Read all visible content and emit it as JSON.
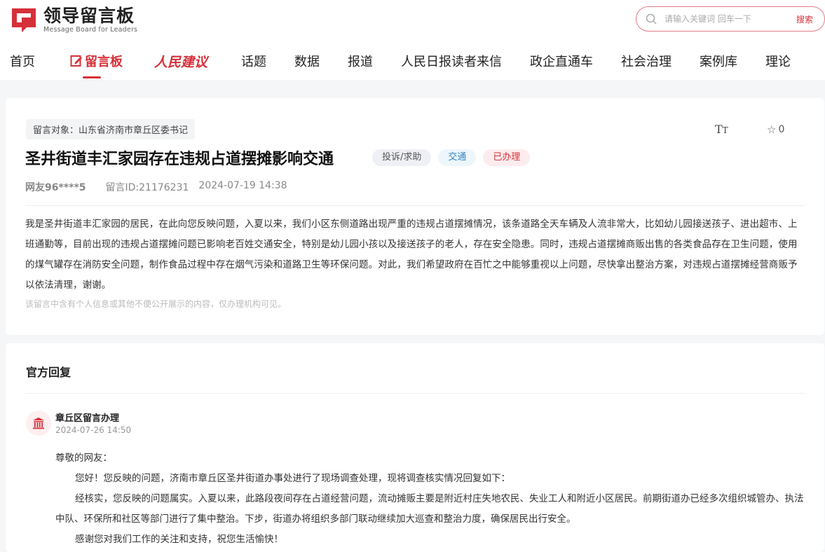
{
  "header": {
    "logo_cn": "领导留言板",
    "logo_en": "Message Board for Leaders",
    "search_placeholder": "请输入关键词 回车一下",
    "search_button": "搜索",
    "brand_color": "#d6303a"
  },
  "nav": {
    "items": [
      "首页",
      "留言板",
      "人民建议",
      "话题",
      "数据",
      "报道",
      "人民日报读者来信",
      "政企直通车",
      "社会治理",
      "案例库",
      "理论"
    ],
    "active": "留言板"
  },
  "message": {
    "target_label": "留言对象：山东省济南市章丘区委书记",
    "title": "圣井街道丰汇家园存在违规占道摆摊影响交通",
    "badges": [
      "投诉/求助",
      "交通",
      "已办理"
    ],
    "user": "网友96****5",
    "message_id": "留言ID:21176231",
    "datetime": "2024-07-19 14:38",
    "favorites": "0",
    "content": "我是圣井街道丰汇家园的居民，在此向您反映问题，入夏以来，我们小区东侧道路出现严重的违规占道摆摊情况，该条道路全天车辆及人流非常大，比如幼儿园接送孩子、进出超市、上班通勤等，目前出现的违规占道摆摊问题已影响老百姓交通安全，特别是幼儿园小孩以及接送孩子的老人，存在安全隐患。同时，违规占道摆摊商贩出售的各类食品存在卫生问题，使用的煤气罐存在消防安全问题，制作食品过程中存在烟气污染和道路卫生等环保问题。对此，我们希望政府在百忙之中能够重视以上问题，尽快拿出整治方案，对违规占道摆摊经营商贩予以依法清理，谢谢。",
    "privacy_note": "该留言中含有个人信息或其他不便公开展示的内容，仅办理机构可见。"
  },
  "reply": {
    "section_title": "官方回复",
    "department": "章丘区留言办理",
    "datetime": "2024-07-26 14:50",
    "greeting": "尊敬的网友：",
    "paragraphs": [
      "您好！您反映的问题，济南市章丘区圣井街道办事处进行了现场调查处理，现将调查核实情况回复如下：",
      "经核实，您反映的问题属实。入夏以来，此路段夜间存在占道经营问题，流动摊贩主要是附近村庄失地农民、失业工人和附近小区居民。前期街道办已经多次组织城管办、执法中队、环保所和社区等部门进行了集中整治。下步，街道办将组织多部门联动继续加大巡查和整治力度，确保居民出行安全。",
      "感谢您对我们工作的关注和支持，祝您生活愉快！"
    ]
  }
}
